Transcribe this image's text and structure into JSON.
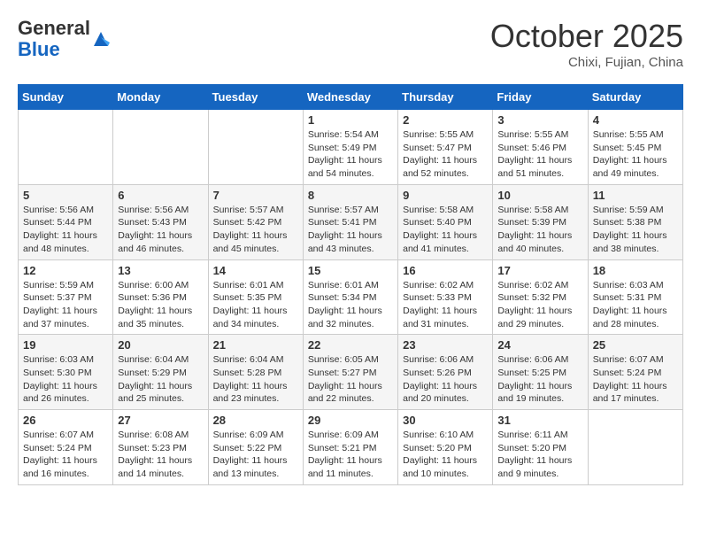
{
  "header": {
    "logo_general": "General",
    "logo_blue": "Blue",
    "month_title": "October 2025",
    "location": "Chixi, Fujian, China"
  },
  "weekdays": [
    "Sunday",
    "Monday",
    "Tuesday",
    "Wednesday",
    "Thursday",
    "Friday",
    "Saturday"
  ],
  "weeks": [
    [
      {
        "day": "",
        "info": ""
      },
      {
        "day": "",
        "info": ""
      },
      {
        "day": "",
        "info": ""
      },
      {
        "day": "1",
        "info": "Sunrise: 5:54 AM\nSunset: 5:49 PM\nDaylight: 11 hours and 54 minutes."
      },
      {
        "day": "2",
        "info": "Sunrise: 5:55 AM\nSunset: 5:47 PM\nDaylight: 11 hours and 52 minutes."
      },
      {
        "day": "3",
        "info": "Sunrise: 5:55 AM\nSunset: 5:46 PM\nDaylight: 11 hours and 51 minutes."
      },
      {
        "day": "4",
        "info": "Sunrise: 5:55 AM\nSunset: 5:45 PM\nDaylight: 11 hours and 49 minutes."
      }
    ],
    [
      {
        "day": "5",
        "info": "Sunrise: 5:56 AM\nSunset: 5:44 PM\nDaylight: 11 hours and 48 minutes."
      },
      {
        "day": "6",
        "info": "Sunrise: 5:56 AM\nSunset: 5:43 PM\nDaylight: 11 hours and 46 minutes."
      },
      {
        "day": "7",
        "info": "Sunrise: 5:57 AM\nSunset: 5:42 PM\nDaylight: 11 hours and 45 minutes."
      },
      {
        "day": "8",
        "info": "Sunrise: 5:57 AM\nSunset: 5:41 PM\nDaylight: 11 hours and 43 minutes."
      },
      {
        "day": "9",
        "info": "Sunrise: 5:58 AM\nSunset: 5:40 PM\nDaylight: 11 hours and 41 minutes."
      },
      {
        "day": "10",
        "info": "Sunrise: 5:58 AM\nSunset: 5:39 PM\nDaylight: 11 hours and 40 minutes."
      },
      {
        "day": "11",
        "info": "Sunrise: 5:59 AM\nSunset: 5:38 PM\nDaylight: 11 hours and 38 minutes."
      }
    ],
    [
      {
        "day": "12",
        "info": "Sunrise: 5:59 AM\nSunset: 5:37 PM\nDaylight: 11 hours and 37 minutes."
      },
      {
        "day": "13",
        "info": "Sunrise: 6:00 AM\nSunset: 5:36 PM\nDaylight: 11 hours and 35 minutes."
      },
      {
        "day": "14",
        "info": "Sunrise: 6:01 AM\nSunset: 5:35 PM\nDaylight: 11 hours and 34 minutes."
      },
      {
        "day": "15",
        "info": "Sunrise: 6:01 AM\nSunset: 5:34 PM\nDaylight: 11 hours and 32 minutes."
      },
      {
        "day": "16",
        "info": "Sunrise: 6:02 AM\nSunset: 5:33 PM\nDaylight: 11 hours and 31 minutes."
      },
      {
        "day": "17",
        "info": "Sunrise: 6:02 AM\nSunset: 5:32 PM\nDaylight: 11 hours and 29 minutes."
      },
      {
        "day": "18",
        "info": "Sunrise: 6:03 AM\nSunset: 5:31 PM\nDaylight: 11 hours and 28 minutes."
      }
    ],
    [
      {
        "day": "19",
        "info": "Sunrise: 6:03 AM\nSunset: 5:30 PM\nDaylight: 11 hours and 26 minutes."
      },
      {
        "day": "20",
        "info": "Sunrise: 6:04 AM\nSunset: 5:29 PM\nDaylight: 11 hours and 25 minutes."
      },
      {
        "day": "21",
        "info": "Sunrise: 6:04 AM\nSunset: 5:28 PM\nDaylight: 11 hours and 23 minutes."
      },
      {
        "day": "22",
        "info": "Sunrise: 6:05 AM\nSunset: 5:27 PM\nDaylight: 11 hours and 22 minutes."
      },
      {
        "day": "23",
        "info": "Sunrise: 6:06 AM\nSunset: 5:26 PM\nDaylight: 11 hours and 20 minutes."
      },
      {
        "day": "24",
        "info": "Sunrise: 6:06 AM\nSunset: 5:25 PM\nDaylight: 11 hours and 19 minutes."
      },
      {
        "day": "25",
        "info": "Sunrise: 6:07 AM\nSunset: 5:24 PM\nDaylight: 11 hours and 17 minutes."
      }
    ],
    [
      {
        "day": "26",
        "info": "Sunrise: 6:07 AM\nSunset: 5:24 PM\nDaylight: 11 hours and 16 minutes."
      },
      {
        "day": "27",
        "info": "Sunrise: 6:08 AM\nSunset: 5:23 PM\nDaylight: 11 hours and 14 minutes."
      },
      {
        "day": "28",
        "info": "Sunrise: 6:09 AM\nSunset: 5:22 PM\nDaylight: 11 hours and 13 minutes."
      },
      {
        "day": "29",
        "info": "Sunrise: 6:09 AM\nSunset: 5:21 PM\nDaylight: 11 hours and 11 minutes."
      },
      {
        "day": "30",
        "info": "Sunrise: 6:10 AM\nSunset: 5:20 PM\nDaylight: 11 hours and 10 minutes."
      },
      {
        "day": "31",
        "info": "Sunrise: 6:11 AM\nSunset: 5:20 PM\nDaylight: 11 hours and 9 minutes."
      },
      {
        "day": "",
        "info": ""
      }
    ]
  ]
}
